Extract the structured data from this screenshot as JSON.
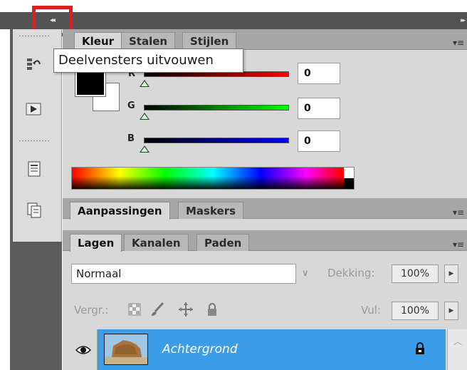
{
  "tooltip": {
    "text": "Deelvensters uitvouwen"
  },
  "dock": {
    "collapse_glyph": "◂◂",
    "expand_glyph": "▸▸"
  },
  "color_panel": {
    "tabs": [
      "Kleur",
      "Stalen",
      "Stijlen"
    ],
    "active_tab": "Kleur",
    "channels": [
      {
        "letter": "R",
        "value": "0",
        "slider_level": 0
      },
      {
        "letter": "G",
        "value": "0",
        "slider_level": 0
      },
      {
        "letter": "B",
        "value": "0",
        "slider_level": 0
      }
    ],
    "foreground": "#000000",
    "background": "#ffffff"
  },
  "adjust_panel": {
    "tabs": [
      "Aanpassingen",
      "Maskers"
    ],
    "active_tab": "Aanpassingen"
  },
  "layers_panel": {
    "tabs": [
      "Lagen",
      "Kanalen",
      "Paden"
    ],
    "active_tab": "Lagen",
    "blend_mode": "Normaal",
    "opacity_label": "Dekking:",
    "opacity_value": "100%",
    "lock_label": "Vergr.:",
    "fill_label": "Vul:",
    "fill_value": "100%",
    "layers": [
      {
        "name": "Achtergrond",
        "selected": true,
        "locked": true,
        "visible": true
      }
    ]
  },
  "colors": {
    "selection": "#3b9ce8",
    "highlight_box": "#e11c1c"
  }
}
